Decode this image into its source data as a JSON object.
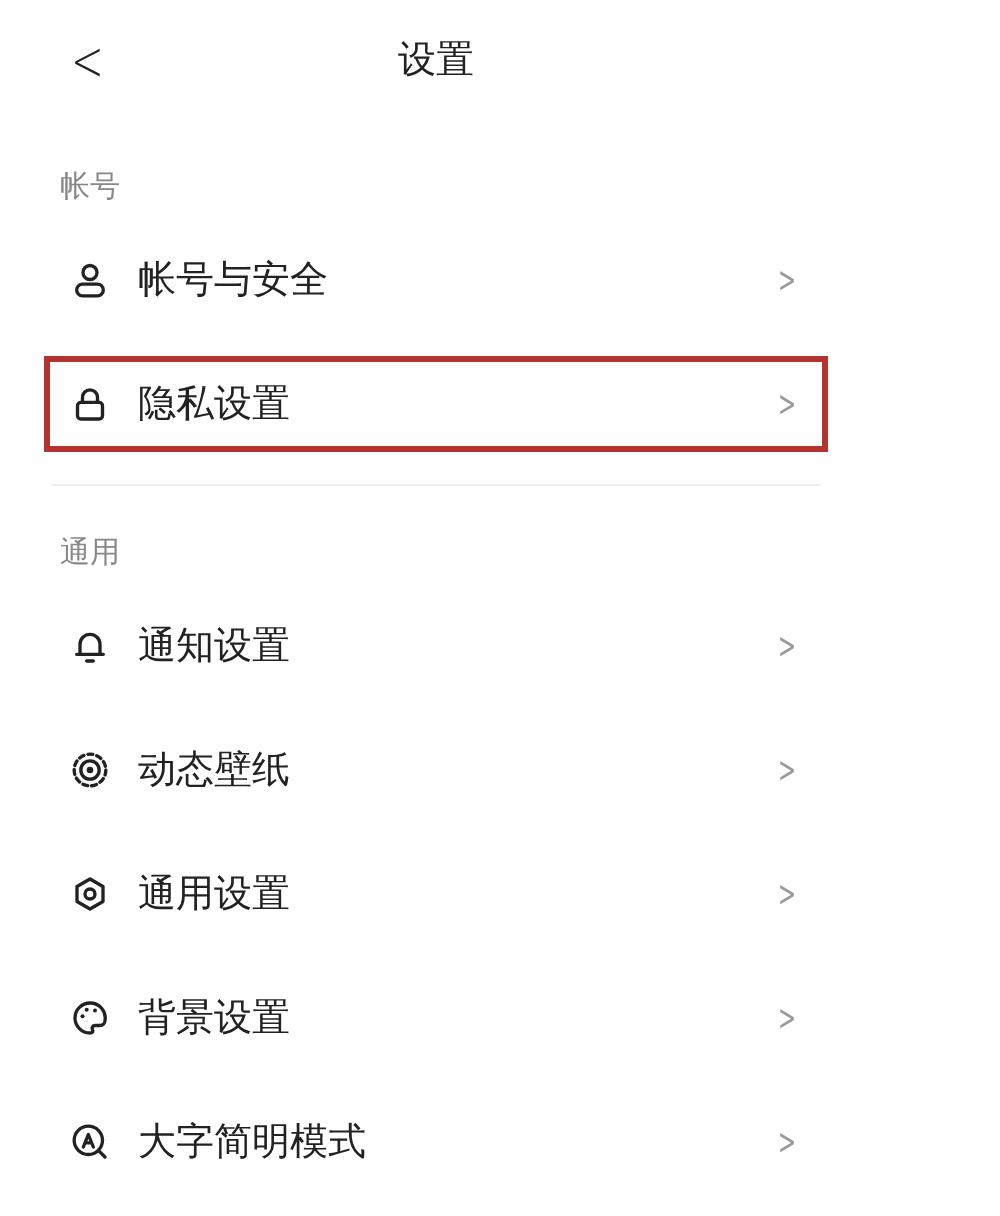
{
  "header": {
    "back": "<",
    "title": "设置"
  },
  "sections": [
    {
      "title": "帐号",
      "items": [
        {
          "kind": "person",
          "label": "帐号与安全",
          "chevron": ">",
          "highlighted": false
        },
        {
          "kind": "lock",
          "label": "隐私设置",
          "chevron": ">",
          "highlighted": true
        }
      ]
    },
    {
      "title": "通用",
      "items": [
        {
          "kind": "bell",
          "label": "通知设置",
          "chevron": ">",
          "highlighted": false
        },
        {
          "kind": "wallpaper",
          "label": "动态壁纸",
          "chevron": ">",
          "highlighted": false
        },
        {
          "kind": "gear",
          "label": "通用设置",
          "chevron": ">",
          "highlighted": false
        },
        {
          "kind": "palette",
          "label": "背景设置",
          "chevron": ">",
          "highlighted": false
        },
        {
          "kind": "textsize",
          "label": "大字简明模式",
          "chevron": ">",
          "highlighted": false
        }
      ]
    }
  ]
}
